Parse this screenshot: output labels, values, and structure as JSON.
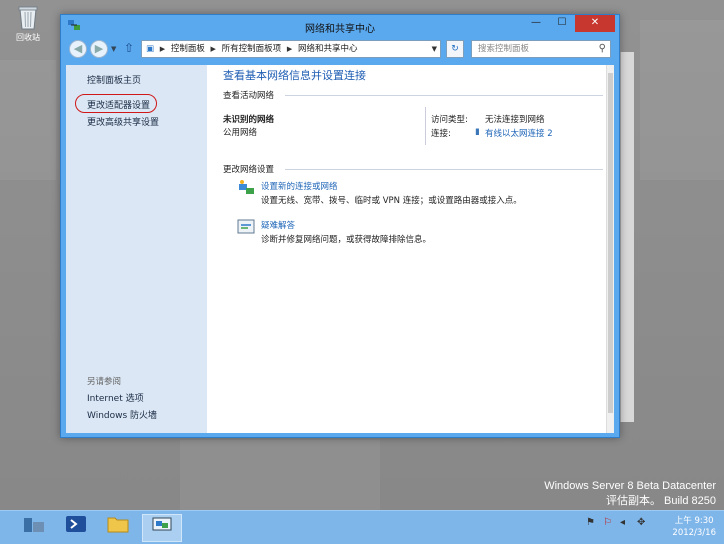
{
  "desktop": {
    "recycle_bin_label": "回收站",
    "watermark_line1": "Windows Server 8 Beta Datacenter",
    "watermark_line2": "评估副本。 Build 8250"
  },
  "window": {
    "title": "网络和共享中心",
    "minimize": "—",
    "maximize": "☐",
    "close": "✕"
  },
  "address": {
    "crumbs": [
      "控制面板",
      "所有控制面板项",
      "网络和共享中心"
    ],
    "search_placeholder": "搜索控制面板"
  },
  "sidebar": {
    "home": "控制面板主页",
    "adapter_settings": "更改适配器设置",
    "advanced_sharing": "更改高级共享设置",
    "see_also": "另请参阅",
    "internet_options": "Internet 选项",
    "firewall": "Windows 防火墙"
  },
  "main": {
    "heading": "查看基本网络信息并设置连接",
    "active_networks_title": "查看活动网络",
    "network_name": "未识别的网络",
    "network_type": "公用网络",
    "access_type_label": "访问类型:",
    "access_type_value": "无法连接到网络",
    "connection_label": "连接:",
    "connection_value": "有线以太网连接 2",
    "change_settings_title": "更改网络设置",
    "setup_link": "设置新的连接或网络",
    "setup_desc": "设置无线、宽带、拨号、临时或 VPN 连接；或设置路由器或接入点。",
    "troubleshoot_link": "疑难解答",
    "troubleshoot_desc": "诊断并修复网络问题，或获得故障排除信息。"
  },
  "taskbar": {
    "clock_time": "上午 9:30",
    "clock_date": "2012/3/16"
  }
}
